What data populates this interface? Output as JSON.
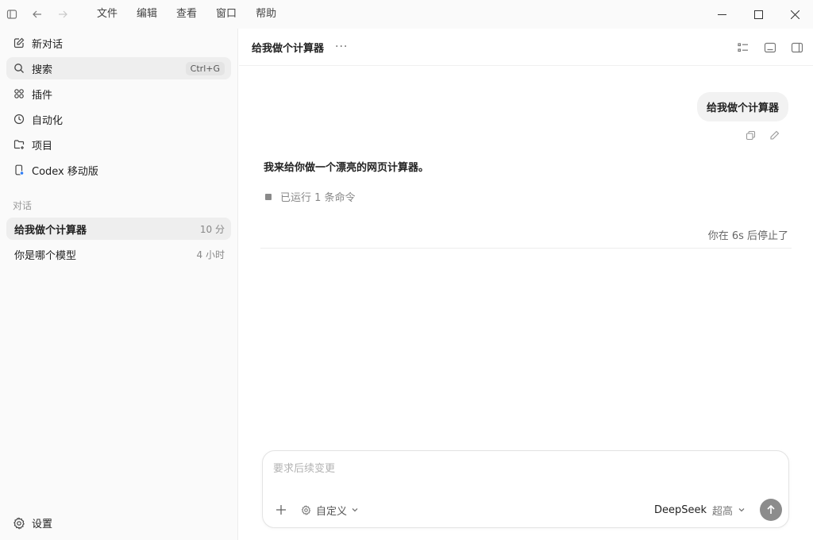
{
  "titlebar": {
    "menu": [
      "文件",
      "编辑",
      "查看",
      "窗口",
      "帮助"
    ]
  },
  "sidebar": {
    "nav": [
      {
        "label": "新对话",
        "icon": "edit-icon"
      },
      {
        "label": "搜索",
        "icon": "search-icon",
        "shortcut": "Ctrl+G"
      },
      {
        "label": "插件",
        "icon": "grid-icon"
      },
      {
        "label": "自动化",
        "icon": "clock-icon"
      },
      {
        "label": "项目",
        "icon": "folder-plus-icon"
      },
      {
        "label": "Codex 移动版",
        "icon": "phone-icon"
      }
    ],
    "section_label": "对话",
    "conversations": [
      {
        "title": "给我做个计算器",
        "time": "10 分"
      },
      {
        "title": "你是哪个模型",
        "time": "4 小时"
      }
    ],
    "settings_label": "设置"
  },
  "main": {
    "title": "给我做个计算器",
    "more": "···",
    "user_message": "给我做个计算器",
    "assistant_message": "我来给你做一个漂亮的网页计算器。",
    "command_status": "已运行 1 条命令",
    "stopped_text": "你在 6s 后停止了"
  },
  "composer": {
    "placeholder": "要求后续变更",
    "mode": "自定义",
    "model": "DeepSeek",
    "level": "超高"
  },
  "colors": {
    "sidebar_bg": "#fafafa",
    "active_bg": "#eeeeee",
    "send_button": "#8c8c8c"
  }
}
